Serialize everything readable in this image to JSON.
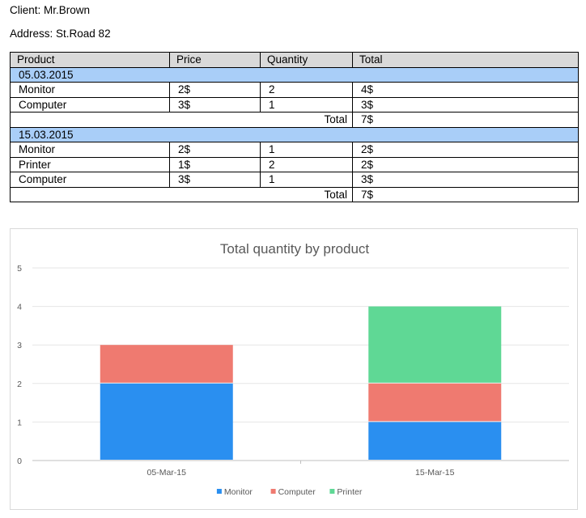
{
  "header": {
    "client": "Client: Mr.Brown",
    "address": "Address: St.Road 82"
  },
  "table": {
    "columns": [
      "Product",
      "Price",
      "Quantity",
      "Total"
    ],
    "groups": [
      {
        "date": "05.03.2015",
        "rows": [
          {
            "product": "Monitor",
            "price": "2$",
            "quantity": "2",
            "total": "4$"
          },
          {
            "product": "Computer",
            "price": "3$",
            "quantity": "1",
            "total": "3$"
          }
        ],
        "total_label": "Total",
        "total_value": "7$"
      },
      {
        "date": "15.03.2015",
        "rows": [
          {
            "product": "Monitor",
            "price": "2$",
            "quantity": "1",
            "total": "2$"
          },
          {
            "product": "Printer",
            "price": "1$",
            "quantity": "2",
            "total": "2$"
          },
          {
            "product": "Computer",
            "price": "3$",
            "quantity": "1",
            "total": "3$"
          }
        ],
        "total_label": "Total",
        "total_value": "7$"
      }
    ]
  },
  "chart_data": {
    "type": "bar",
    "stacked": true,
    "title": "Total quantity by product",
    "categories": [
      "05-Mar-15",
      "15-Mar-15"
    ],
    "series": [
      {
        "name": "Monitor",
        "values": [
          2,
          1
        ],
        "color": "#2a8ff0"
      },
      {
        "name": "Computer",
        "values": [
          1,
          1
        ],
        "color": "#ef7a70"
      },
      {
        "name": "Printer",
        "values": [
          0,
          2
        ],
        "color": "#5fd895"
      }
    ],
    "ylim": [
      0,
      5
    ],
    "yticks": [
      "0",
      "1",
      "2",
      "3",
      "4",
      "5"
    ],
    "grid": true,
    "legend": "bottom",
    "xlabel": "",
    "ylabel": ""
  }
}
